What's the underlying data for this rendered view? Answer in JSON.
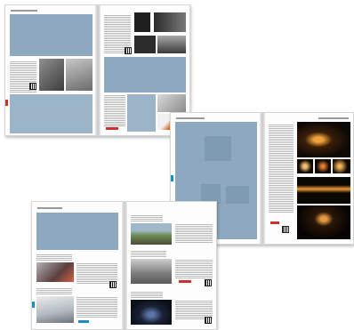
{
  "colors": {
    "tint": "#8ea9bf",
    "accent_red": "#d0302a",
    "accent_cyan": "#1a8fc4",
    "orange": "#e0641e",
    "neon": "#f0a23c"
  },
  "icons": [
    "qr-code-icon",
    "page-tab-marker-icon"
  ]
}
